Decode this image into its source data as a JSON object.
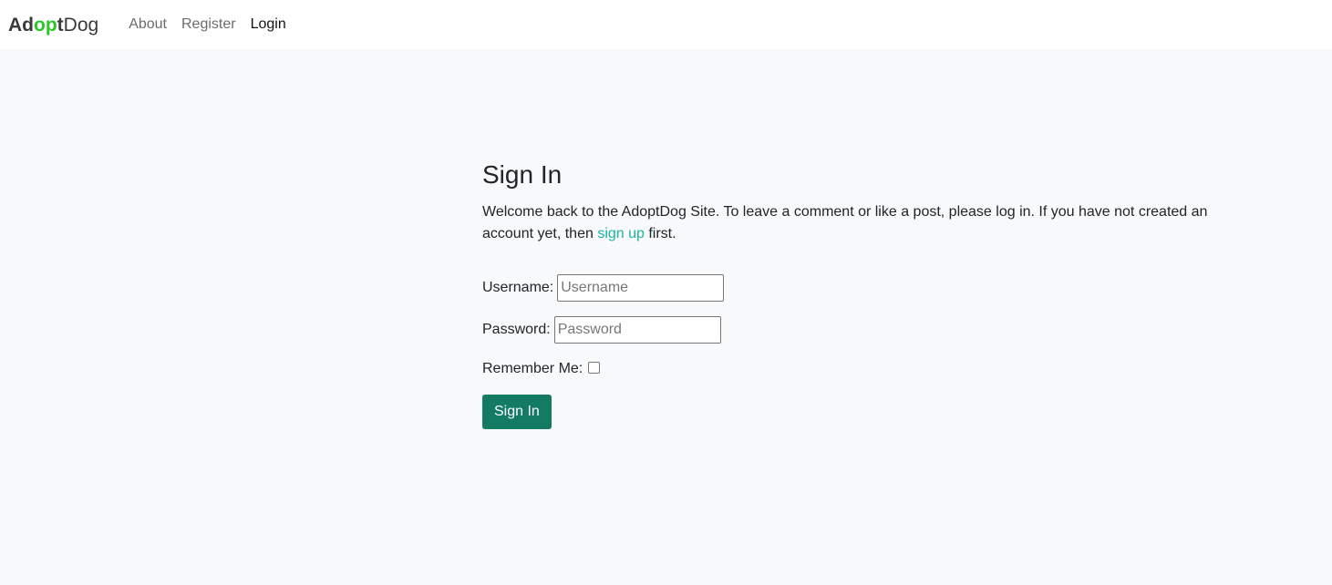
{
  "nav": {
    "brand": {
      "part1": "Ad",
      "accent": "op",
      "part2": "t",
      "part3": "Dog"
    },
    "links": [
      {
        "label": "About",
        "active": false
      },
      {
        "label": "Register",
        "active": false
      },
      {
        "label": "Login",
        "active": true
      }
    ]
  },
  "colors": {
    "brand_accent": "#28c728",
    "primary_button": "#137a63",
    "link": "#1ab5a3",
    "background": "#f8f9fa"
  },
  "signin": {
    "title": "Sign In",
    "intro_before": "Welcome back to the AdoptDog Site. To leave a comment or like a post, please log in. If you have not created an account yet, then ",
    "intro_link": "sign up",
    "intro_after": " first.",
    "username_label": "Username:",
    "username_placeholder": "Username",
    "username_value": "",
    "password_label": "Password:",
    "password_placeholder": "Password",
    "password_value": "",
    "remember_label": "Remember Me:",
    "remember_checked": false,
    "submit_label": "Sign In"
  }
}
